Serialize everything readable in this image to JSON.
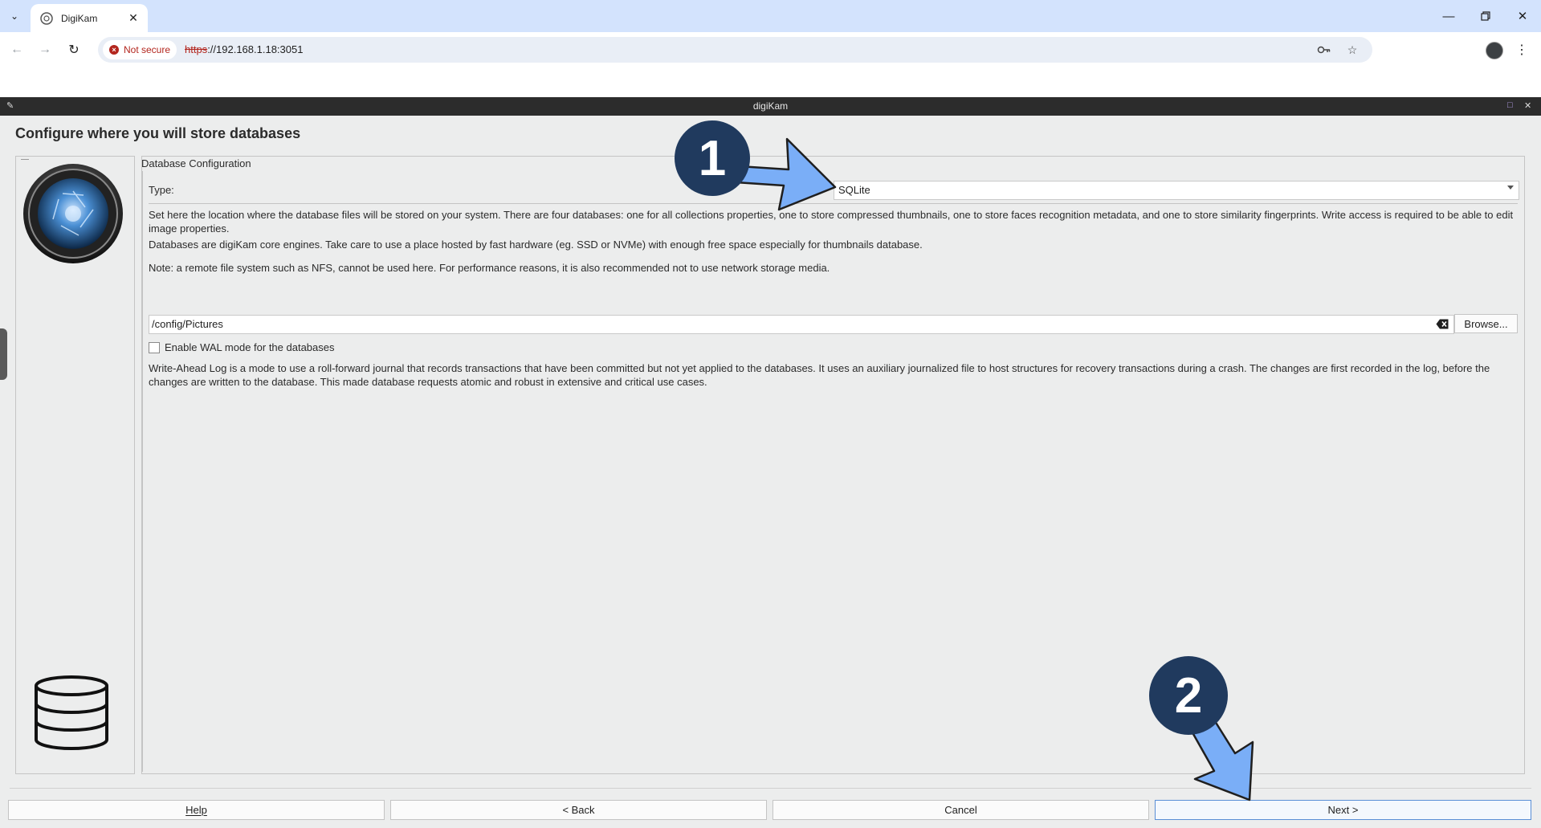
{
  "browser": {
    "tab_title": "DigiKam",
    "security_label": "Not secure",
    "url_scheme": "https",
    "url_rest": "://192.168.1.18:3051"
  },
  "app": {
    "window_title": "digiKam",
    "page_heading": "Configure where you will store databases",
    "group_title": "Database Configuration",
    "type_label": "Type:",
    "type_value": "SQLite",
    "para1": "Set here the location where the database files will be stored on your system. There are four databases: one for all collections properties, one to store compressed thumbnails, one to store faces recognition metadata, and one to store similarity fingerprints. Write access is required to be able to edit image properties.",
    "para2": "Databases are digiKam core engines. Take care to use a place hosted by fast hardware (eg. SSD or NVMe) with enough free space especially for thumbnails database.",
    "para3": "Note: a remote file system such as NFS, cannot be used here. For performance reasons, it is also recommended not to use network storage media.",
    "path_value": "/config/Pictures",
    "browse_label": "Browse...",
    "wal_label": "Enable WAL mode for the databases",
    "wal_checked": false,
    "wal_description": "Write-Ahead Log is a mode to use a roll-forward journal that records transactions that have been committed but not yet applied to the databases. It uses an auxiliary journalized file to host structures for recovery transactions during a crash. The changes are first recorded in the log, before the changes are written to the database. This made database requests atomic and robust in extensive and critical use cases."
  },
  "buttons": {
    "help": "Help",
    "back": "< Back",
    "cancel": "Cancel",
    "next": "Next >"
  },
  "annotations": {
    "step1": "1",
    "step2": "2",
    "badge_color": "#203a5e",
    "arrow_color": "#7aaef7"
  }
}
